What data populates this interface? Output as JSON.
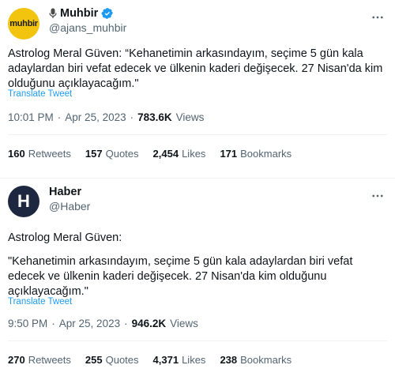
{
  "tweets": [
    {
      "avatar_text": "muhbir",
      "display_name": "Muhbir",
      "handle": "@ajans_muhbir",
      "verified": true,
      "text": "Astrolog Meral Güven: “Kehanetimin arkasındayım, seçime 5 gün kala adaylardan biri vefat edecek ve ülkenin kaderi değişecek. 27 Nisan'da kim olduğunu açıklayacağım.\"",
      "translate": "Translate Tweet",
      "time": "10:01 PM",
      "date": "Apr 25, 2023",
      "views_count": "783.6K",
      "views_label": "Views",
      "stats": [
        {
          "count": "160",
          "label": "Retweets"
        },
        {
          "count": "157",
          "label": "Quotes"
        },
        {
          "count": "2,454",
          "label": "Likes"
        },
        {
          "count": "171",
          "label": "Bookmarks"
        }
      ]
    },
    {
      "avatar_text": "H",
      "display_name": "Haber",
      "handle": "@Haber",
      "verified": false,
      "text_line1": "Astrolog Meral Güven:",
      "text_line2": "\"Kehanetimin arkasındayım, seçime 5 gün kala adaylardan biri vefat edecek ve ülkenin kaderi değişecek. 27 Nisan'da kim olduğunu açıklayacağım.\"",
      "translate": "Translate Tweet",
      "time": "9:50 PM",
      "date": "Apr 25, 2023",
      "views_count": "946.2K",
      "views_label": "Views",
      "stats": [
        {
          "count": "270",
          "label": "Retweets"
        },
        {
          "count": "255",
          "label": "Quotes"
        },
        {
          "count": "4,371",
          "label": "Likes"
        },
        {
          "count": "238",
          "label": "Bookmarks"
        }
      ]
    }
  ],
  "icons": {
    "more": "more-horizontal-icon",
    "verified": "verified-badge-icon",
    "mic": "microphone-icon"
  },
  "colors": {
    "muhbir_avatar_bg": "#f3c40d",
    "haber_avatar_bg": "#1d2740",
    "link": "#1d9bf0",
    "verified": "#1d9bf0"
  }
}
